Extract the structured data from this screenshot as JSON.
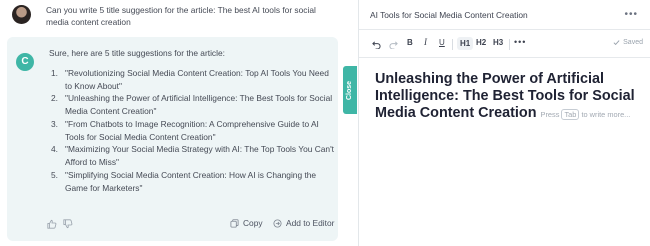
{
  "chat": {
    "user_message": "Can you write 5 title suggestion for the article: The best AI tools for social media content creation",
    "assistant_logo_letter": "C",
    "reply_intro": "Sure, here are 5 title suggestions for the article:",
    "reply_items": [
      {
        "num": "1.",
        "text": "\"Revolutionizing Social Media Content Creation: Top AI Tools You Need to Know About\""
      },
      {
        "num": "2.",
        "text": "\"Unleashing the Power of Artificial Intelligence: The Best Tools for Social Media Content Creation\""
      },
      {
        "num": "3.",
        "text": "\"From Chatbots to Image Recognition: A Comprehensive Guide to AI Tools for Social Media Content Creation\""
      },
      {
        "num": "4.",
        "text": "\"Maximizing Your Social Media Strategy with AI: The Top Tools You Can't Afford to Miss\""
      },
      {
        "num": "5.",
        "text": "\"Simplifying Social Media Content Creation: How AI is Changing the Game for Marketers\""
      }
    ],
    "copy_label": "Copy",
    "add_to_editor_label": "Add to Editor"
  },
  "close_tab_label": "Close",
  "editor": {
    "doc_title": "AI Tools for Social Media Content Creation",
    "more_icon": "more-horizontal-icon",
    "toolbar": {
      "bold": "B",
      "italic": "I",
      "underline": "U",
      "h1": "H1",
      "h2": "H2",
      "h3": "H3",
      "saved": "Saved"
    },
    "heading": "Unleashing the Power of Artificial Intelligence: The Best Tools for Social Media Content Creation",
    "hint_prefix": "Press",
    "hint_key": "Tab",
    "hint_suffix": "to write more..."
  },
  "colors": {
    "accent": "#3fb6a6",
    "reply_bg": "#eef5f6",
    "heading": "#1f2233"
  }
}
